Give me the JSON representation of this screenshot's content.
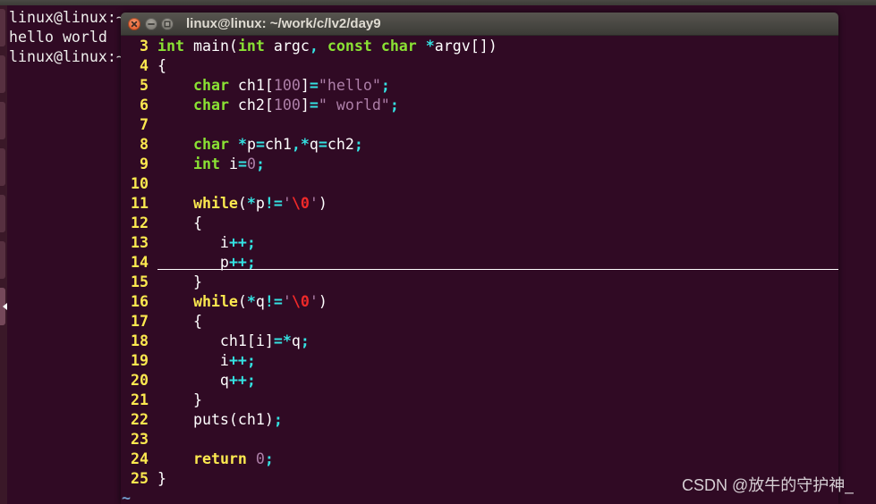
{
  "background_terminal": {
    "lines": [
      "linux@linux:~",
      "hello world",
      "linux@linux:~"
    ]
  },
  "window": {
    "title": "linux@linux: ~/work/c/lv2/day9",
    "buttons": [
      {
        "name": "close",
        "icon": "close-icon"
      },
      {
        "name": "minimize",
        "icon": "minimize-icon"
      },
      {
        "name": "maximize",
        "icon": "maximize-icon"
      }
    ]
  },
  "editor": {
    "cursor_line": "14",
    "lines": [
      {
        "number": "3",
        "tokens": [
          [
            "int",
            "type"
          ],
          [
            " main(",
            "normal"
          ],
          [
            "int",
            "type"
          ],
          [
            " argc",
            "normal"
          ],
          [
            ",",
            "operator"
          ],
          [
            " ",
            "normal"
          ],
          [
            "const",
            "type"
          ],
          [
            " ",
            "normal"
          ],
          [
            "char",
            "type"
          ],
          [
            " ",
            "normal"
          ],
          [
            "*",
            "operator"
          ],
          [
            "argv[])",
            "normal"
          ]
        ]
      },
      {
        "number": "4",
        "tokens": [
          [
            "{",
            "normal"
          ]
        ]
      },
      {
        "number": "5",
        "tokens": [
          [
            "    ",
            "normal"
          ],
          [
            "char",
            "type"
          ],
          [
            " ch1[",
            "normal"
          ],
          [
            "100",
            "constant"
          ],
          [
            "]",
            "normal"
          ],
          [
            "=",
            "operator"
          ],
          [
            "\"hello\"",
            "constant"
          ],
          [
            ";",
            "operator"
          ]
        ]
      },
      {
        "number": "6",
        "tokens": [
          [
            "    ",
            "normal"
          ],
          [
            "char",
            "type"
          ],
          [
            " ch2[",
            "normal"
          ],
          [
            "100",
            "constant"
          ],
          [
            "]",
            "normal"
          ],
          [
            "=",
            "operator"
          ],
          [
            "\" world\"",
            "constant"
          ],
          [
            ";",
            "operator"
          ]
        ]
      },
      {
        "number": "7",
        "tokens": []
      },
      {
        "number": "8",
        "tokens": [
          [
            "    ",
            "normal"
          ],
          [
            "char",
            "type"
          ],
          [
            " ",
            "normal"
          ],
          [
            "*",
            "operator"
          ],
          [
            "p",
            "normal"
          ],
          [
            "=",
            "operator"
          ],
          [
            "ch1",
            "normal"
          ],
          [
            ",*",
            "operator"
          ],
          [
            "q",
            "normal"
          ],
          [
            "=",
            "operator"
          ],
          [
            "ch2",
            "normal"
          ],
          [
            ";",
            "operator"
          ]
        ]
      },
      {
        "number": "9",
        "tokens": [
          [
            "    ",
            "normal"
          ],
          [
            "int",
            "type"
          ],
          [
            " i",
            "normal"
          ],
          [
            "=",
            "operator"
          ],
          [
            "0",
            "constant"
          ],
          [
            ";",
            "operator"
          ]
        ]
      },
      {
        "number": "10",
        "tokens": []
      },
      {
        "number": "11",
        "tokens": [
          [
            "    ",
            "normal"
          ],
          [
            "while",
            "statement"
          ],
          [
            "(",
            "normal"
          ],
          [
            "*",
            "operator"
          ],
          [
            "p",
            "normal"
          ],
          [
            "!=",
            "operator"
          ],
          [
            "'",
            "constant"
          ],
          [
            "\\0",
            "special"
          ],
          [
            "'",
            "constant"
          ],
          [
            ")",
            "normal"
          ]
        ]
      },
      {
        "number": "12",
        "tokens": [
          [
            "    {",
            "normal"
          ]
        ]
      },
      {
        "number": "13",
        "tokens": [
          [
            "       i",
            "normal"
          ],
          [
            "++;",
            "operator"
          ]
        ]
      },
      {
        "number": "14",
        "tokens": [
          [
            "       p",
            "normal"
          ],
          [
            "++;",
            "operator"
          ]
        ]
      },
      {
        "number": "15",
        "tokens": [
          [
            "    }",
            "normal"
          ]
        ]
      },
      {
        "number": "16",
        "tokens": [
          [
            "    ",
            "normal"
          ],
          [
            "while",
            "statement"
          ],
          [
            "(",
            "normal"
          ],
          [
            "*",
            "operator"
          ],
          [
            "q",
            "normal"
          ],
          [
            "!=",
            "operator"
          ],
          [
            "'",
            "constant"
          ],
          [
            "\\0",
            "special"
          ],
          [
            "'",
            "constant"
          ],
          [
            ")",
            "normal"
          ]
        ]
      },
      {
        "number": "17",
        "tokens": [
          [
            "    {",
            "normal"
          ]
        ]
      },
      {
        "number": "18",
        "tokens": [
          [
            "       ch1[i]",
            "normal"
          ],
          [
            "=*",
            "operator"
          ],
          [
            "q",
            "normal"
          ],
          [
            ";",
            "operator"
          ]
        ]
      },
      {
        "number": "19",
        "tokens": [
          [
            "       i",
            "normal"
          ],
          [
            "++;",
            "operator"
          ]
        ]
      },
      {
        "number": "20",
        "tokens": [
          [
            "       q",
            "normal"
          ],
          [
            "++;",
            "operator"
          ]
        ]
      },
      {
        "number": "21",
        "tokens": [
          [
            "    }",
            "normal"
          ]
        ]
      },
      {
        "number": "22",
        "tokens": [
          [
            "    puts(ch1)",
            "normal"
          ],
          [
            ";",
            "operator"
          ]
        ]
      },
      {
        "number": "23",
        "tokens": []
      },
      {
        "number": "24",
        "tokens": [
          [
            "    ",
            "normal"
          ],
          [
            "return",
            "statement"
          ],
          [
            " ",
            "normal"
          ],
          [
            "0",
            "constant"
          ],
          [
            ";",
            "operator"
          ]
        ]
      },
      {
        "number": "25",
        "tokens": [
          [
            "}",
            "normal"
          ]
        ]
      }
    ],
    "end_of_buffer_marker": "~"
  },
  "syntax_colors": {
    "normal": "#ffffff",
    "line_number": "#fce94f",
    "type": "#8ae234",
    "statement": "#fce94f",
    "operator": "#34e2e2",
    "constant": "#ad7fa8",
    "special": "#ef2929",
    "non_text": "#729fcf"
  },
  "theme": {
    "terminal_background": "#300a24",
    "titlebar": "#3c3b37",
    "close_button": "#e95420"
  },
  "watermark": "CSDN @放牛的守护神_"
}
